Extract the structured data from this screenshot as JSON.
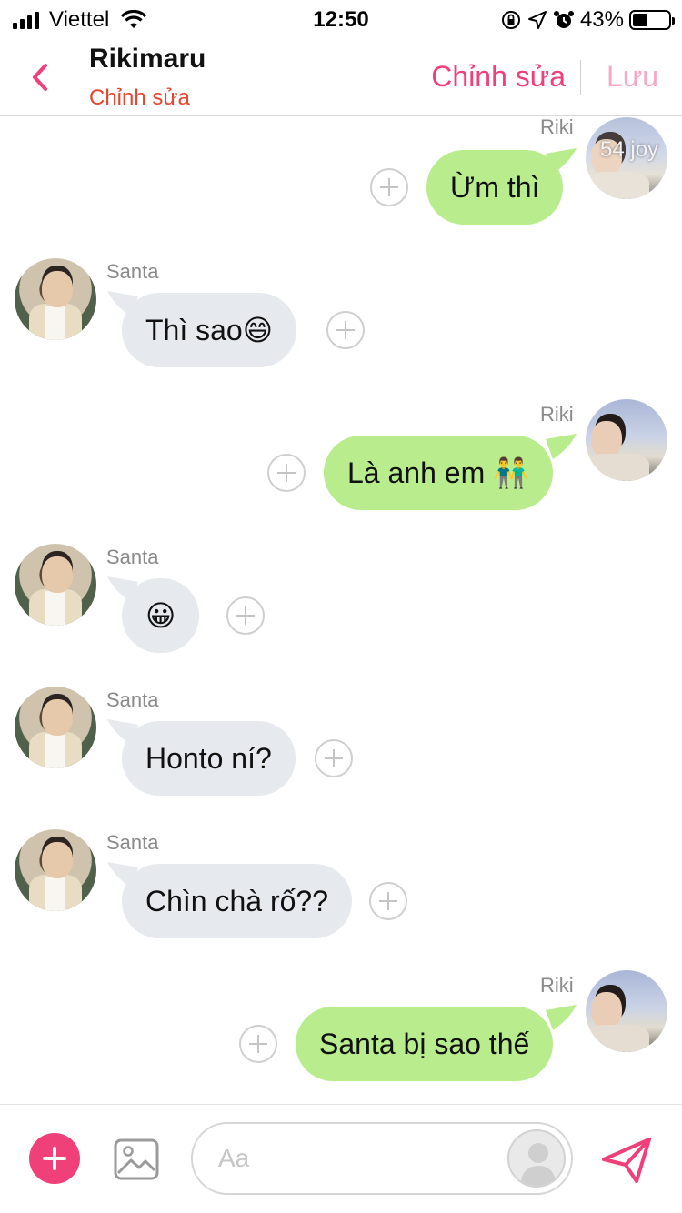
{
  "status_bar": {
    "carrier": "Viettel",
    "time": "12:50",
    "battery": "43%",
    "battery_level": 0.43,
    "icons": [
      "signal-icon",
      "wifi-icon",
      "orientation-lock-icon",
      "location-icon",
      "alarm-icon",
      "battery-icon"
    ]
  },
  "header": {
    "title": "Rikimaru",
    "subtitle": "Chỉnh sửa",
    "edit_label": "Chỉnh sửa",
    "save_label": "Lưu"
  },
  "messages": [
    {
      "sender": "Riki",
      "side": "out",
      "text": "Ừm thì",
      "avatar_overlay": "54 joy"
    },
    {
      "sender": "Santa",
      "side": "in",
      "text": "Thì sao😄"
    },
    {
      "sender": "Riki",
      "side": "out",
      "text": "Là anh em 👬"
    },
    {
      "sender": "Santa",
      "side": "in",
      "text": "😀"
    },
    {
      "sender": "Santa",
      "side": "in",
      "text": "Honto ní?"
    },
    {
      "sender": "Santa",
      "side": "in",
      "text": "Chìn chà rố??"
    },
    {
      "sender": "Riki",
      "side": "out",
      "text": "Santa bị sao thế"
    }
  ],
  "composer": {
    "placeholder": "Aa",
    "value": ""
  },
  "colors": {
    "accent": "#f0407a",
    "subtitle": "#e8452e",
    "bubble_in": "#e6e9ed",
    "bubble_out": "#b9ec8d",
    "save_disabled": "#f6a9c4"
  }
}
